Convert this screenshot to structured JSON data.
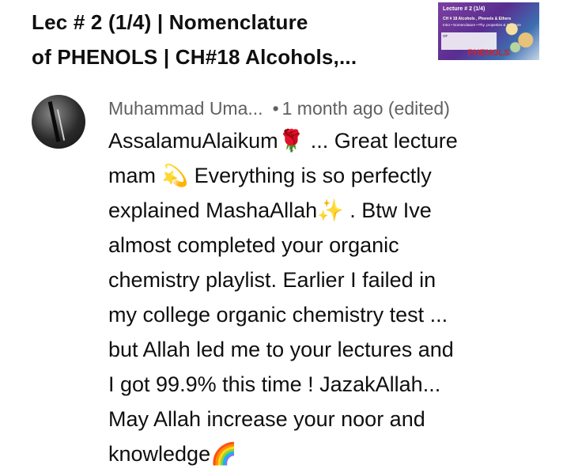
{
  "video": {
    "title_line1": "Lec # 2 (1/4) | Nomenclature",
    "title_line2": "of PHENOLS  | CH#18 Alcohols,...",
    "thumbnail": {
      "top_text": "Lecture # 2 (1/4)",
      "subtitle": "CH # 18 Alcohols , Phenols & Ethers",
      "topics": "Intro • Nomenclature • Phy. properties & Structure",
      "card_text": "OF",
      "caption": "PHENOLS"
    }
  },
  "comment": {
    "author": "Muhammad Uma...",
    "separator": "•",
    "time": "1 month ago (edited)",
    "lines": [
      "AssalamuAlaikum🌹 ... Great lecture",
      "mam 💫 Everything is so perfectly",
      "explained MashaAllah✨ . Btw Ive",
      "almost completed your organic",
      "chemistry playlist. Earlier I failed in",
      "my college organic chemistry test ...",
      "but Allah led me to your lectures and",
      "I got 99.9% this time ! JazakAllah...",
      "May Allah increase your noor and",
      "knowledge🌈"
    ]
  },
  "icons": {
    "avatar": "user-avatar"
  }
}
